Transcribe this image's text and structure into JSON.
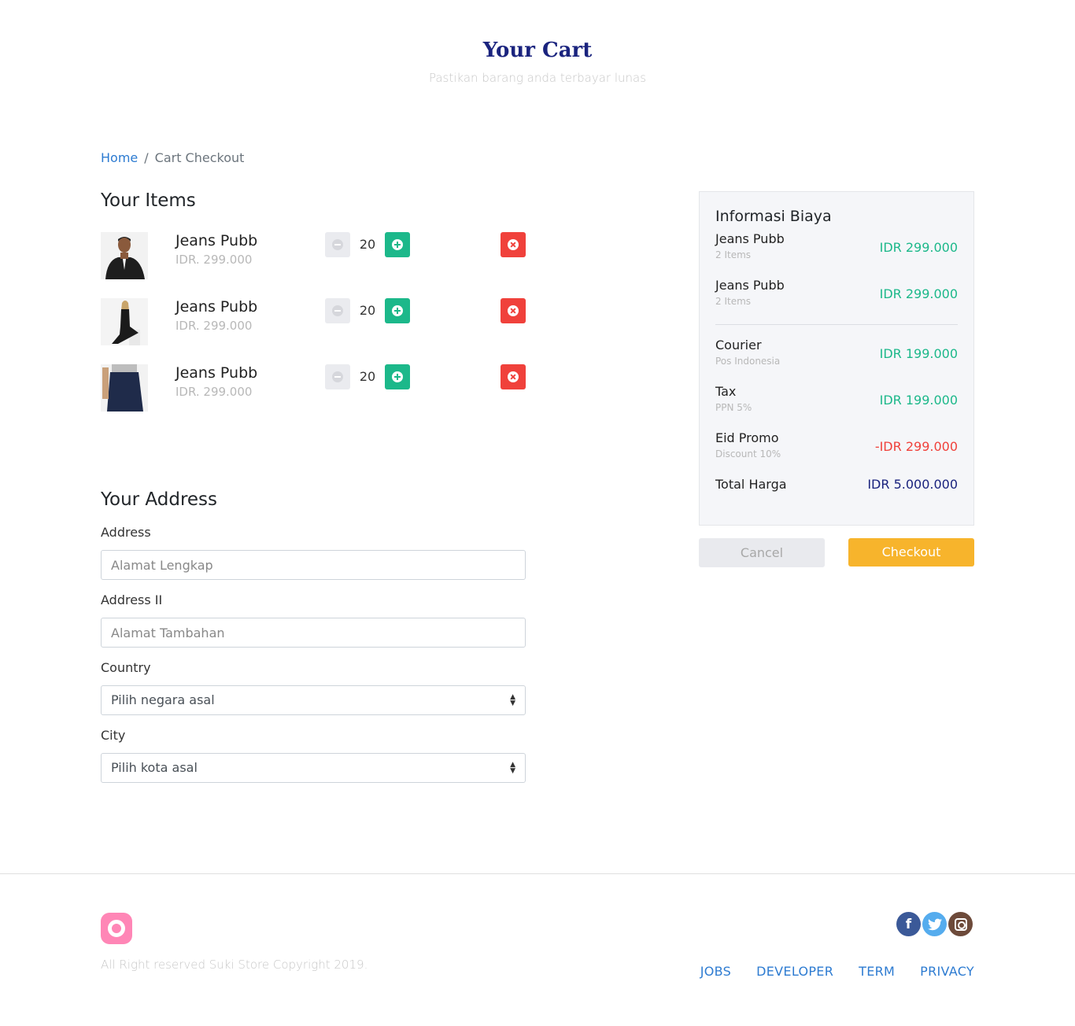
{
  "hero": {
    "title": "Your Cart",
    "subtitle": "Pastikan barang anda terbayar lunas"
  },
  "breadcrumb": {
    "home": "Home",
    "separator": "/",
    "current": "Cart Checkout"
  },
  "items_section": {
    "title": "Your Items",
    "items": [
      {
        "name": "Jeans Pubb",
        "price": "IDR. 299.000",
        "qty": "20"
      },
      {
        "name": "Jeans Pubb",
        "price": "IDR. 299.000",
        "qty": "20"
      },
      {
        "name": "Jeans Pubb",
        "price": "IDR. 299.000",
        "qty": "20"
      }
    ]
  },
  "address_section": {
    "title": "Your Address",
    "address_label": "Address",
    "address_placeholder": "Alamat Lengkap",
    "address2_label": "Address II",
    "address2_placeholder": "Alamat Tambahan",
    "country_label": "Country",
    "country_value": "Pilih negara asal",
    "city_label": "City",
    "city_value": "Pilih kota asal"
  },
  "summary": {
    "title": "Informasi Biaya",
    "lines": [
      {
        "label": "Jeans Pubb",
        "sub": "2 Items",
        "amount": "IDR 299.000"
      },
      {
        "label": "Jeans Pubb",
        "sub": "2 Items",
        "amount": "IDR 299.000"
      }
    ],
    "courier": {
      "label": "Courier",
      "sub": "Pos Indonesia",
      "amount": "IDR 199.000"
    },
    "tax": {
      "label": "Tax",
      "sub": "PPN 5%",
      "amount": "IDR 199.000"
    },
    "promo": {
      "label": "Eid Promo",
      "sub": "Discount 10%",
      "amount": "-IDR 299.000"
    },
    "total": {
      "label": "Total Harga",
      "amount": "IDR 5.000.000"
    }
  },
  "actions": {
    "cancel": "Cancel",
    "checkout": "Checkout"
  },
  "footer": {
    "copyright": "All Right reserved Suki Store Copyright 2019.",
    "links": [
      "JOBS",
      "DEVELOPER",
      "TERM",
      "PRIVACY"
    ],
    "social": [
      "facebook-icon",
      "twitter-icon",
      "instagram-icon"
    ]
  },
  "colors": {
    "title": "#1a237e",
    "accent_green": "#1cb88a",
    "danger": "#f0413b",
    "checkout": "#f7b42c",
    "link": "#2d7bd1",
    "logo": "#ff86b6"
  }
}
